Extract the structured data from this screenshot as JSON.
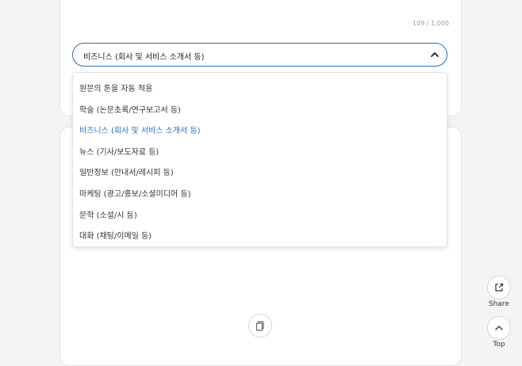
{
  "editor": {
    "char_count": "109 / 1,000"
  },
  "select": {
    "value": "비즈니스 (회사 및 서비스 소개서 등)",
    "options": [
      "원문의 톤을 자동 적용",
      "학술 (논문초록/연구보고서 등)",
      "비즈니스 (회사 및 서비스 소개서 등)",
      "뉴스 (기사/보도자료 등)",
      "일반정보 (안내서/레시피 등)",
      "마케팅 (광고/홍보/소셜미디어 등)",
      "문학 (소설/시 등)",
      "대화 (채팅/이메일 등)"
    ],
    "selected_index": 2
  },
  "floating": {
    "share_label": "Share",
    "top_label": "Top"
  },
  "colors": {
    "accent": "#2c6fb7",
    "background": "#f3f4f6"
  }
}
